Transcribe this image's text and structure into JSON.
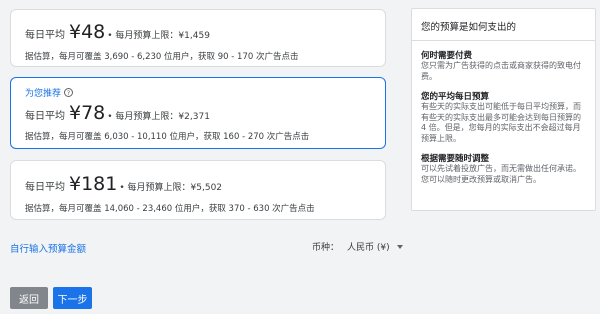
{
  "options": [
    {
      "label": "每日平均",
      "amount": "¥48",
      "cap": "• 每月预算上限：¥1,459",
      "estimate": "据估算，每月可覆盖 3,690 - 6,230 位用户，获取 90 - 170 次广告点击"
    },
    {
      "recommended": "为您推荐",
      "help_icon": "?",
      "label": "每日平均",
      "amount": "¥78",
      "cap": "• 每月预算上限：¥2,371",
      "estimate": "据估算，每月可覆盖 6,030 - 10,110 位用户，获取 160 - 270 次广告点击"
    },
    {
      "label": "每日平均",
      "amount": "¥181",
      "cap": "• 每月预算上限：¥5,502",
      "estimate": "据估算，每月可覆盖 14,060 - 23,460 位用户，获取 370 - 630 次广告点击"
    }
  ],
  "custom_link": "自行输入预算金额",
  "currency": {
    "label": "币种：",
    "value": "人民币 (¥)"
  },
  "buttons": {
    "back": "返回",
    "next": "下一步"
  },
  "panel": {
    "title": "您的预算是如何支出的",
    "sections": [
      {
        "heading": "何时需要付费",
        "body": "您只需为广告获得的点击或商家获得的致电付费。"
      },
      {
        "heading": "您的平均每日预算",
        "body": "有些天的实际支出可能低于每日平均预算，而有些天的实际支出最多可能会达到每日预算的 4 倍。但是，您每月的实际支出不会超过每月预算上限。"
      },
      {
        "heading": "根据需要随时调整",
        "body": "可以先试着投放广告，而无需做出任何承诺。您可以随时更改预算或取消广告。"
      }
    ]
  }
}
